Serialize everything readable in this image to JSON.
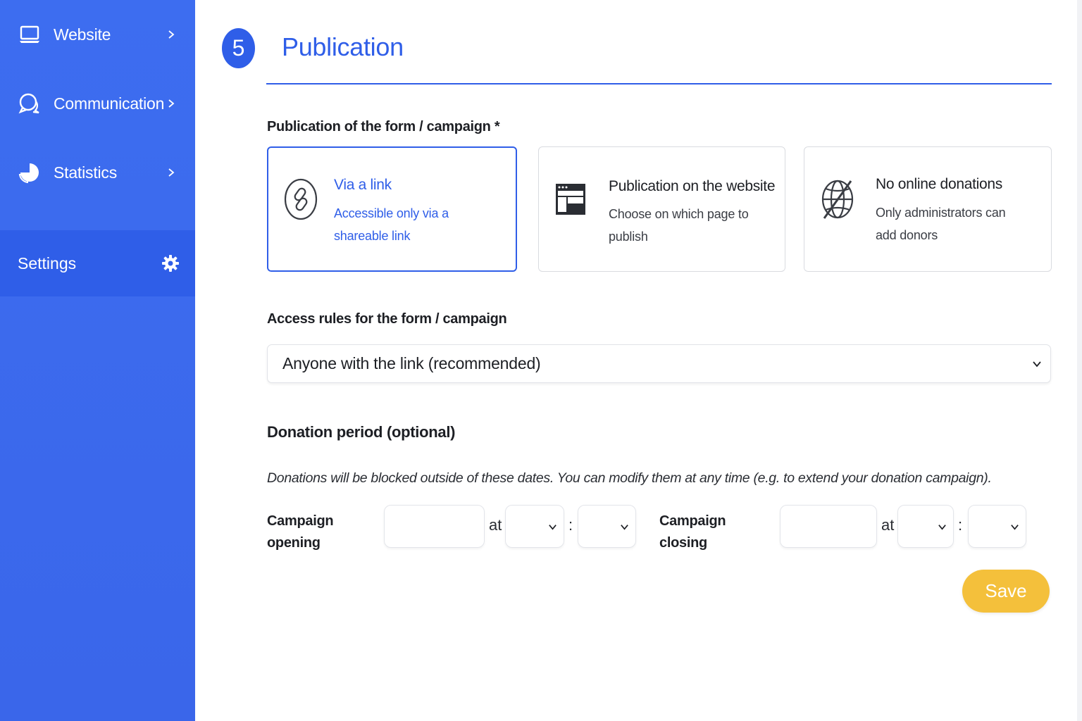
{
  "sidebar": {
    "items": [
      {
        "label": "Website",
        "icon": "laptop-icon"
      },
      {
        "label": "Communication",
        "icon": "chat-bubbles-icon"
      },
      {
        "label": "Statistics",
        "icon": "pie-chart-icon"
      }
    ],
    "settings": {
      "label": "Settings",
      "icon": "gear-icon"
    }
  },
  "header": {
    "step": "5",
    "title": "Publication"
  },
  "publication": {
    "label": "Publication of the form / campaign *",
    "options": [
      {
        "title": "Via a link",
        "desc_line1": "Accessible only via a",
        "desc_line2": "shareable link",
        "icon": "link-icon",
        "selected": true
      },
      {
        "title": "Publication on the website",
        "desc_line1": "Choose on which page to publish",
        "desc_line2": "",
        "icon": "webpage-icon",
        "selected": false
      },
      {
        "title": "No online donations",
        "desc_line1": "Only administrators can",
        "desc_line2": "add donors",
        "icon": "globe-off-icon",
        "selected": false
      }
    ]
  },
  "access": {
    "label": "Access rules for the form / campaign",
    "selected": "Anyone with the link (recommended)"
  },
  "donation_period": {
    "label": "Donation period (optional)",
    "help": "Donations will be blocked outside of these dates. You can modify them at any time (e.g. to extend your donation campaign).",
    "opening": {
      "label_line1": "Campaign",
      "label_line2": "opening",
      "date": "",
      "hour": "",
      "minute": ""
    },
    "closing": {
      "label_line1": "Campaign",
      "label_line2": "closing",
      "date": "",
      "hour": "",
      "minute": ""
    },
    "at_text": "at",
    "colon_text": ":"
  },
  "actions": {
    "save_label": "Save"
  },
  "colors": {
    "primary": "#2f5ee8",
    "sidebar": "#3d6df0",
    "save": "#f4c03b"
  }
}
